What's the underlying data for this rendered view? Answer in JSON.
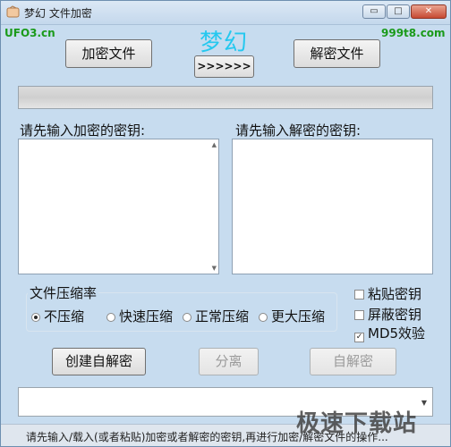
{
  "window": {
    "title": "梦幻 文件加密",
    "minimize_glyph": "▭",
    "maximize_glyph": "□",
    "close_glyph": "✕"
  },
  "watermarks": {
    "top_left": "UFO3.cn",
    "top_right": "999t8.com",
    "bottom_right": "极速下载站"
  },
  "header": {
    "encrypt_file_button": "加密文件",
    "brand": "梦幻",
    "arrow_button": ">>>>>>",
    "decrypt_file_button": "解密文件"
  },
  "progress": {
    "value_percent": 0
  },
  "keys": {
    "encrypt_label": "请先输入加密的密钥:",
    "decrypt_label": "请先输入解密的密钥:",
    "encrypt_value": "",
    "decrypt_value": ""
  },
  "compression": {
    "title": "文件压缩率",
    "options": [
      "不压缩",
      "快速压缩",
      "正常压缩",
      "更大压缩"
    ],
    "selected": "不压缩"
  },
  "checkboxes": [
    {
      "label": "粘贴密钥",
      "checked": false
    },
    {
      "label": "屏蔽密钥",
      "checked": false
    },
    {
      "label": "MD5效验",
      "checked": true
    }
  ],
  "actions": {
    "create_self_extract": "创建自解密",
    "separate": "分离",
    "self_decrypt": "自解密"
  },
  "combo": {
    "value": ""
  },
  "status": {
    "text": "请先输入/载入(或者粘贴)加密或者解密的密钥,再进行加密/解密文件的操作..."
  },
  "colors": {
    "window_bg": "#c7dcef",
    "brand": "#25c8ef",
    "watermark_green": "#1a9a1a"
  }
}
